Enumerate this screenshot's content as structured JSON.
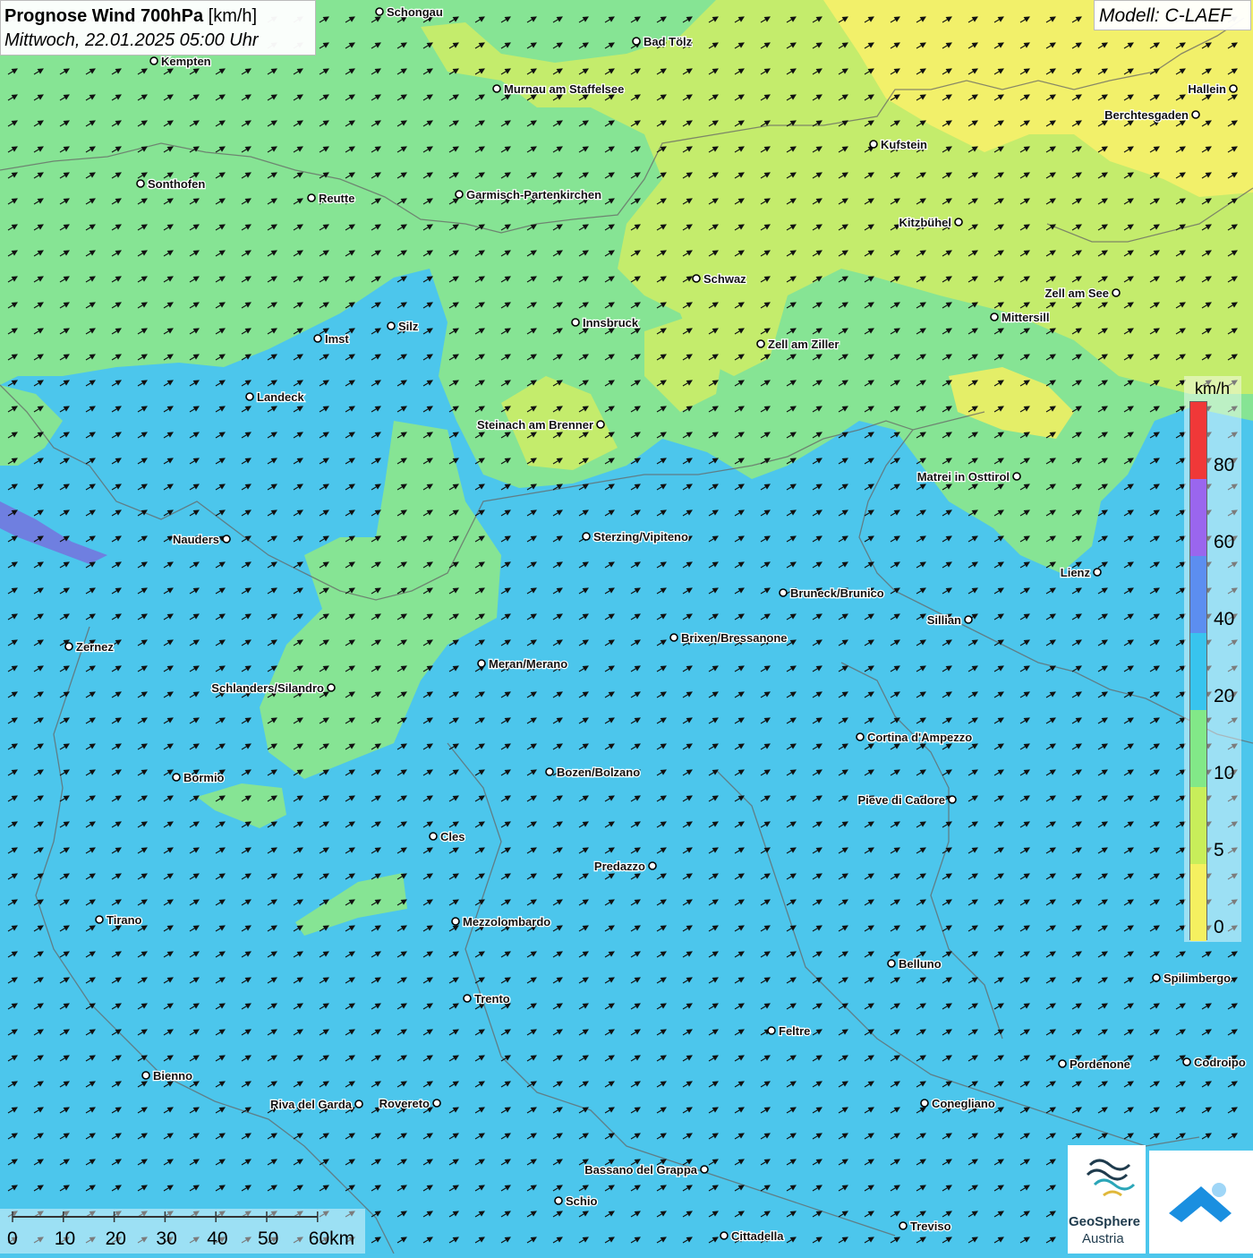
{
  "title": {
    "bold": "Prognose Wind 700hPa",
    "unit": "[km/h]",
    "datetime": "Mittwoch, 22.01.2025 05:00 Uhr"
  },
  "model": "Modell: C-LAEF",
  "legend": {
    "unit": "km/h",
    "ticks": [
      "0",
      "5",
      "10",
      "20",
      "40",
      "60",
      "80"
    ],
    "colors": [
      "#f5f060",
      "#c8ee5a",
      "#82e888",
      "#38c4ee",
      "#5c8ef0",
      "#9a66ee",
      "#f03838"
    ]
  },
  "scale_bar": {
    "ticks": [
      "0",
      "10",
      "20",
      "30",
      "40",
      "50",
      "60km"
    ]
  },
  "logos": {
    "geosphere_line1": "GeoSphere",
    "geosphere_line2": "Austria",
    "weather_icon": "cloud-sun-logo-icon"
  },
  "wind_direction": "south-west wind, arrows pointing north-east",
  "cities": [
    {
      "name": "Schongau"
    },
    {
      "name": "Bad Tölz"
    },
    {
      "name": "Kempten"
    },
    {
      "name": "Murnau am Staffelsee"
    },
    {
      "name": "Hallein"
    },
    {
      "name": "Berchtesgaden"
    },
    {
      "name": "Kufstein"
    },
    {
      "name": "Sonthofen"
    },
    {
      "name": "Reutte"
    },
    {
      "name": "Garmisch-Partenkirchen"
    },
    {
      "name": "Kitzbühel"
    },
    {
      "name": "Schwaz"
    },
    {
      "name": "Zell am See"
    },
    {
      "name": "Mittersill"
    },
    {
      "name": "Innsbruck"
    },
    {
      "name": "Imst"
    },
    {
      "name": "Silz"
    },
    {
      "name": "Zell am Ziller"
    },
    {
      "name": "Landeck"
    },
    {
      "name": "Steinach am Brenner"
    },
    {
      "name": "Matrei in Osttirol"
    },
    {
      "name": "Nauders"
    },
    {
      "name": "Sterzing/Vipiteno"
    },
    {
      "name": "Lienz"
    },
    {
      "name": "Bruneck/Brunico"
    },
    {
      "name": "Sillian"
    },
    {
      "name": "Brixen/Bressanone"
    },
    {
      "name": "Zernez"
    },
    {
      "name": "Meran/Merano"
    },
    {
      "name": "Schlanders/Silandro"
    },
    {
      "name": "Cortina d'Ampezzo"
    },
    {
      "name": "Bozen/Bolzano"
    },
    {
      "name": "Bormio"
    },
    {
      "name": "Pieve di Cadore"
    },
    {
      "name": "Cles"
    },
    {
      "name": "Predazzo"
    },
    {
      "name": "Tirano"
    },
    {
      "name": "Mezzolombardo"
    },
    {
      "name": "Belluno"
    },
    {
      "name": "Spilimbergo"
    },
    {
      "name": "Trento"
    },
    {
      "name": "Feltre"
    },
    {
      "name": "Pordenone"
    },
    {
      "name": "Codroipo"
    },
    {
      "name": "Bienno"
    },
    {
      "name": "Riva del Garda"
    },
    {
      "name": "Rovereto"
    },
    {
      "name": "Conegliano"
    },
    {
      "name": "Bassano del Grappa"
    },
    {
      "name": "Schio"
    },
    {
      "name": "Treviso"
    },
    {
      "name": "Cittadella"
    }
  ]
}
